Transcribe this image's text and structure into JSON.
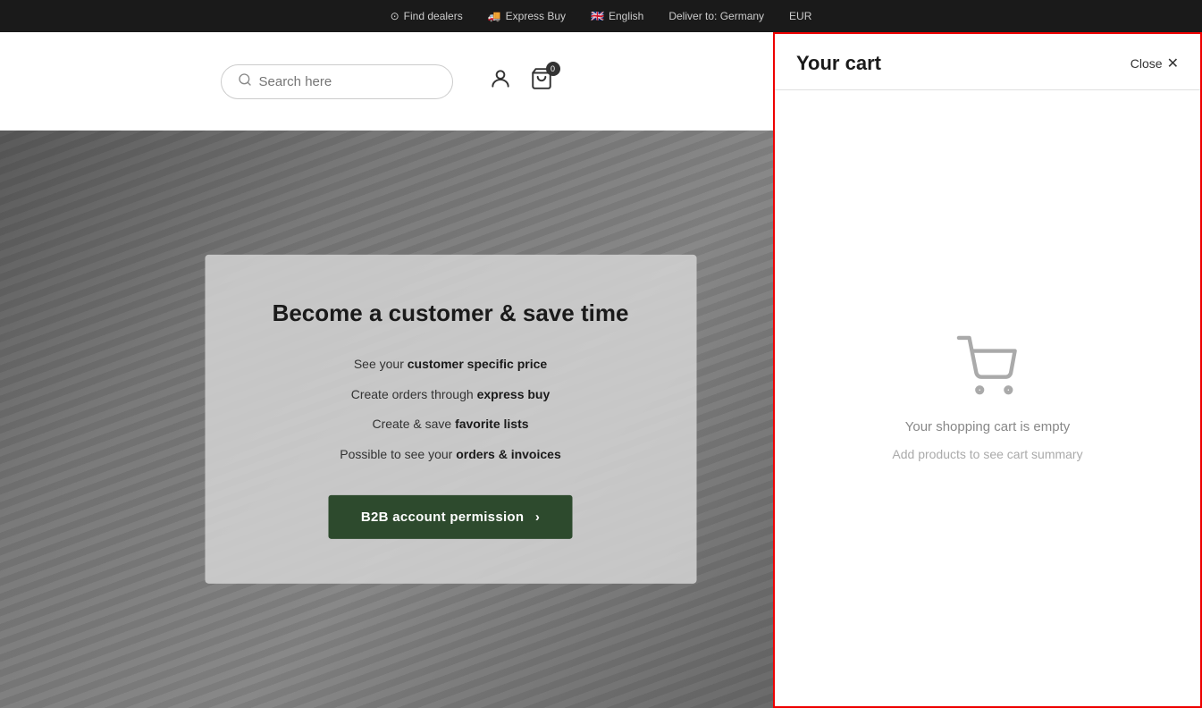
{
  "topbar": {
    "find_dealers": "Find dealers",
    "express_buy": "Express Buy",
    "language": "English",
    "deliver_to": "Deliver to: Germany",
    "currency": "EUR"
  },
  "header": {
    "search_placeholder": "Search here",
    "cart_count": "0"
  },
  "promo": {
    "title": "Become a customer & save time",
    "feature1_prefix": "See your ",
    "feature1_bold": "customer specific price",
    "feature2_prefix": "Create orders through ",
    "feature2_bold": "express buy",
    "feature3_prefix": "Create & save ",
    "feature3_bold": "favorite lists",
    "feature4_prefix": "Possible to see your ",
    "feature4_bold": "orders & invoices",
    "btn_label": "B2B account permission",
    "btn_arrow": "›"
  },
  "cart": {
    "title": "Your cart",
    "close_label": "Close",
    "empty_line1": "Your shopping cart is empty",
    "empty_line2": "Add products to see cart summary"
  }
}
